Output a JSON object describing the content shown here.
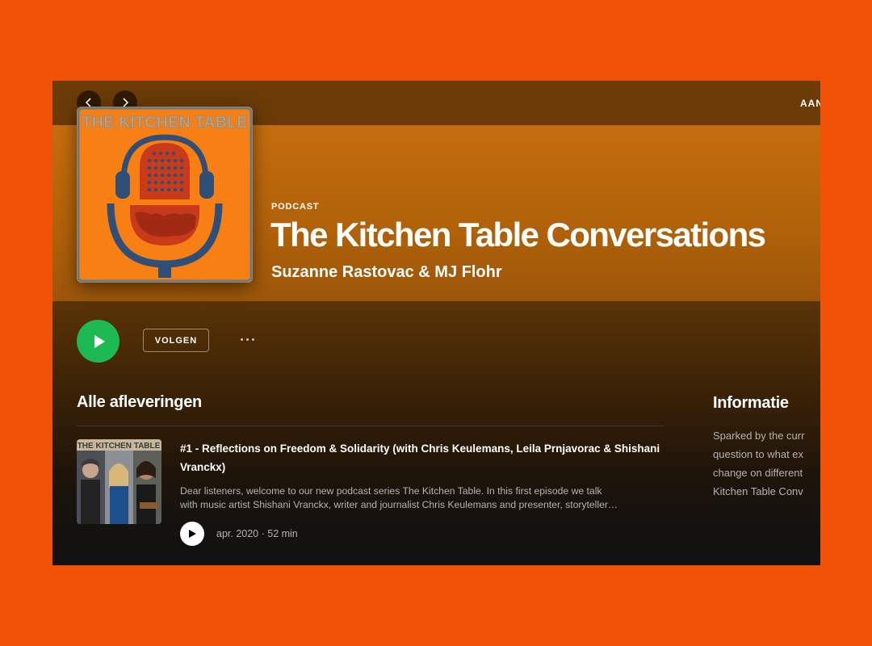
{
  "topbar": {
    "back_label": "back",
    "forward_label": "forward",
    "right_label": "AAN"
  },
  "cover": {
    "cover_text": "THE KITCHEN TABLE"
  },
  "podcast": {
    "type_label": "PODCAST",
    "title": "The Kitchen Table Conversations",
    "author": "Suzanne Rastovac & MJ Flohr"
  },
  "actions": {
    "follow_label": "VOLGEN"
  },
  "episodes": {
    "heading": "Alle afleveringen",
    "items": [
      {
        "thumb_text": "THE KITCHEN TABLE",
        "title": "#1 - Reflections on Freedom & Solidarity (with Chris Keulemans, Leila Prnjavorac & Shishani Vranckx)",
        "desc_line1": "Dear listeners, welcome to our new podcast series The Kitchen Table.  In this first episode we talk",
        "desc_line2": "with music artist Shishani Vranckx, writer and journalist Chris Keulemans and presenter, storyteller…",
        "meta": "apr. 2020 · 52 min"
      }
    ]
  },
  "info": {
    "heading": "Informatie",
    "lines": [
      "Sparked by the curr",
      "question to what ex",
      "change on different",
      "Kitchen Table Conv"
    ]
  },
  "colors": {
    "page_background": "#f25207",
    "accent_green": "#1db954",
    "hero_orange": "#c56d0e"
  }
}
